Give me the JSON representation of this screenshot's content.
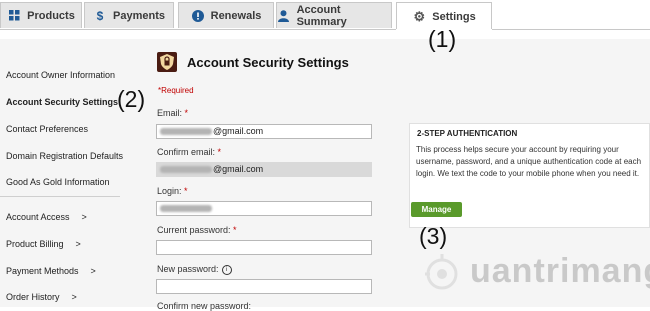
{
  "tabs": [
    {
      "label": "Products",
      "icon": "grid-icon",
      "active": false
    },
    {
      "label": "Payments",
      "icon": "dollar-icon",
      "active": false
    },
    {
      "label": "Renewals",
      "icon": "exclamation-icon",
      "active": false
    },
    {
      "label": "Account Summary",
      "icon": "user-icon",
      "active": false
    },
    {
      "label": "Settings",
      "icon": "gear-icon",
      "active": true
    }
  ],
  "sidebar": {
    "items": [
      {
        "label": "Account Owner Information"
      },
      {
        "label": "Account Security Settings",
        "active": true
      },
      {
        "label": "Contact Preferences"
      },
      {
        "label": "Domain Registration Defaults"
      },
      {
        "label": "Good As Gold Information"
      },
      {
        "label": "Account Access",
        "chevron": ">"
      },
      {
        "label": "Product Billing",
        "chevron": ">"
      },
      {
        "label": "Payment Methods",
        "chevron": ">"
      },
      {
        "label": "Order History",
        "chevron": ">"
      }
    ]
  },
  "main": {
    "title": "Account Security Settings",
    "required_note": "*Required",
    "fields": {
      "email": {
        "label": "Email:",
        "star": "*",
        "value_suffix": "@gmail.com"
      },
      "confirm_email": {
        "label": "Confirm email:",
        "star": "*",
        "value_suffix": "@gmail.com"
      },
      "login": {
        "label": "Login:",
        "star": "*"
      },
      "current_password": {
        "label": "Current password:",
        "star": "*"
      },
      "new_password": {
        "label": "New password:"
      },
      "confirm_new_password": {
        "label": "Confirm new password:"
      }
    }
  },
  "two_step": {
    "title": "2-STEP AUTHENTICATION",
    "text": "This process helps secure your account by requiring your username, password, and a unique authentication code at each login. We text the code to your mobile phone when you need it.",
    "button": "Manage"
  },
  "callouts": [
    "(1)",
    "(2)",
    "(3)"
  ],
  "watermark": "uantrimang",
  "colors": {
    "accent_green": "#5a9a2b",
    "required_red": "#c00000"
  }
}
